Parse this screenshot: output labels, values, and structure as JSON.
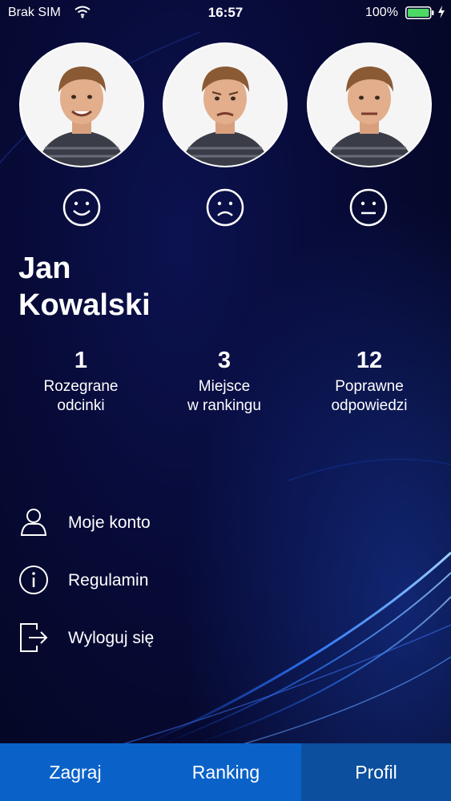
{
  "status_bar": {
    "carrier": "Brak SIM",
    "time": "16:57",
    "battery": "100%",
    "icons": [
      "wifi-icon",
      "battery-icon",
      "charge-icon"
    ]
  },
  "avatars": [
    {
      "mood": "happy",
      "icon": "smile-icon"
    },
    {
      "mood": "sad",
      "icon": "frown-icon"
    },
    {
      "mood": "neutral",
      "icon": "neutral-face-icon"
    }
  ],
  "profile": {
    "first_name": "Jan",
    "last_name": "Kowalski"
  },
  "stats": [
    {
      "value": "1",
      "label_line1": "Rozegrane",
      "label_line2": "odcinki"
    },
    {
      "value": "3",
      "label_line1": "Miejsce",
      "label_line2": "w rankingu"
    },
    {
      "value": "12",
      "label_line1": "Poprawne",
      "label_line2": "odpowiedzi"
    }
  ],
  "menu": [
    {
      "label": "Moje konto",
      "icon": "user-icon"
    },
    {
      "label": "Regulamin",
      "icon": "info-icon"
    },
    {
      "label": "Wyloguj się",
      "icon": "logout-icon"
    }
  ],
  "tabs": [
    {
      "label": "Zagraj",
      "active": false
    },
    {
      "label": "Ranking",
      "active": false
    },
    {
      "label": "Profil",
      "active": true
    }
  ],
  "colors": {
    "background": "#05082a",
    "tab_bar": "#0a62c9",
    "tab_active": "#0b4f9e",
    "text": "#ffffff"
  }
}
